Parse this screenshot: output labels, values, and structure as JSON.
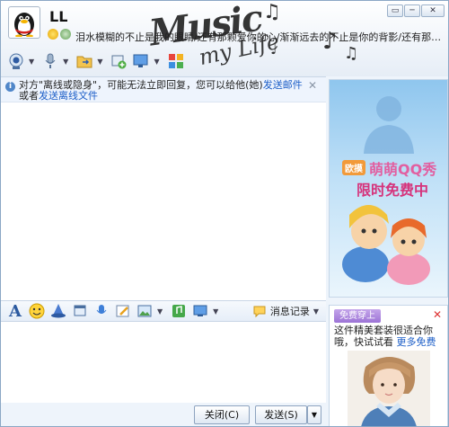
{
  "contact": {
    "nickname": "LL",
    "signature": "泪水模糊的不止是我的眼睛/还有那颗爱你的心/渐渐远去的不止是你的背影/还有那…"
  },
  "skin": {
    "art_text": "Music",
    "art_sub": "my Life"
  },
  "window": {
    "min_label": "▭",
    "max_label": "─",
    "close_label": "✕"
  },
  "toolbar": {
    "items": [
      "video-call",
      "voice-call",
      "send-file",
      "create-group",
      "remote-assist",
      "app-store"
    ]
  },
  "notice": {
    "text": "对方\"离线或隐身\"，可能无法立即回复，您可以给他(她)",
    "link1": "发送邮件",
    "middle": "或者",
    "link2": "发送离线文件",
    "close": "✕"
  },
  "ad": {
    "tag": "欧摸",
    "line1": "萌萌QQ秀",
    "line2": "限时免费中"
  },
  "format_bar": {
    "history_label": "消息记录"
  },
  "buttons": {
    "close": "关闭(C)",
    "send": "发送(S)",
    "send_menu": "▼"
  },
  "promo": {
    "badge": "免费穿上",
    "close": "✕",
    "text": "这件精美套装很适合你哦，快试试看 ",
    "link": "更多免费"
  },
  "colors": {
    "accent": "#1b5dc7",
    "border": "#8ba7c5",
    "panel": "#eef4fb"
  }
}
